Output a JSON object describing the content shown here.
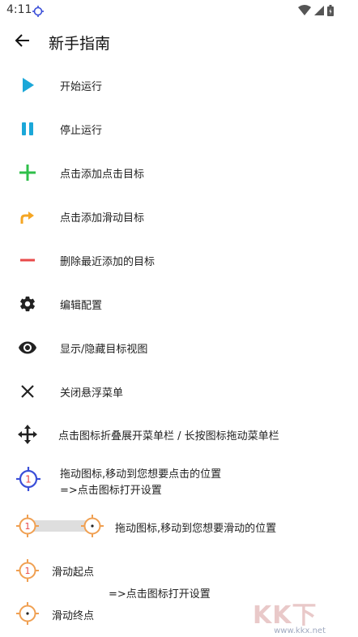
{
  "status": {
    "time": "4:11"
  },
  "header": {
    "title": "新手指南"
  },
  "items": [
    {
      "label": "开始运行",
      "icon": "play-icon",
      "color": "#1ba7d8"
    },
    {
      "label": "停止运行",
      "icon": "pause-icon",
      "color": "#1ba7d8"
    },
    {
      "label": "点击添加点击目标",
      "icon": "plus-icon",
      "color": "#2fbf4a"
    },
    {
      "label": "点击添加滑动目标",
      "icon": "swipe-arrow-icon",
      "color": "#f5a623"
    },
    {
      "label": "删除最近添加的目标",
      "icon": "minus-icon",
      "color": "#e84a4a"
    },
    {
      "label": "编辑配置",
      "icon": "gear-icon",
      "color": "#222222"
    },
    {
      "label": "显示/隐藏目标视图",
      "icon": "eye-icon",
      "color": "#222222"
    },
    {
      "label": "关闭悬浮菜单",
      "icon": "close-icon",
      "color": "#222222"
    },
    {
      "label": "点击图标折叠展开菜单栏 / 长按图标拖动菜单栏",
      "icon": "move-icon",
      "color": "#222222"
    }
  ],
  "guide": {
    "tap_target_number": "1",
    "tap_line1": "拖动图标,移动到您想要点击的位置",
    "tap_line2": "=>点击图标打开设置",
    "swipe_start_number": "1",
    "swipe_desc": "拖动图标,移动到您想要滑动的位置",
    "swipe_start_label": "滑动起点",
    "swipe_settings": "=>点击图标打开设置",
    "swipe_end_label": "滑动终点"
  },
  "watermark": {
    "text": "KK下载",
    "url": "www.kkx.net"
  }
}
